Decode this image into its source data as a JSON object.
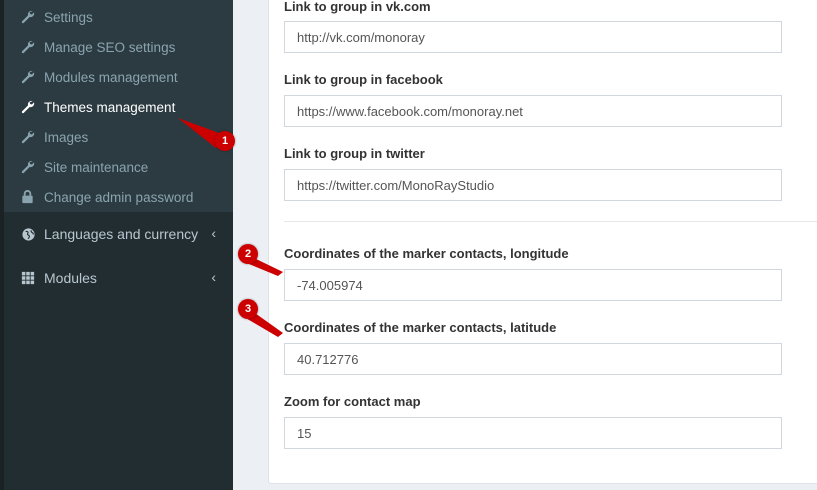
{
  "sidebar": {
    "submenu": [
      {
        "label": "Settings",
        "icon": "wrench-icon"
      },
      {
        "label": "Manage SEO settings",
        "icon": "wrench-icon"
      },
      {
        "label": "Modules management",
        "icon": "wrench-icon"
      },
      {
        "label": "Themes management",
        "icon": "wrench-icon",
        "active": true
      },
      {
        "label": "Images",
        "icon": "wrench-icon"
      },
      {
        "label": "Site maintenance",
        "icon": "wrench-icon"
      },
      {
        "label": "Change admin password",
        "icon": "lock-icon"
      }
    ],
    "menu": [
      {
        "label": "Languages and currency",
        "icon": "globe-icon"
      },
      {
        "label": "Modules",
        "icon": "grid-icon"
      }
    ]
  },
  "form": {
    "vk": {
      "label": "Link to group in vk.com",
      "value": "http://vk.com/monoray"
    },
    "facebook": {
      "label": "Link to group in facebook",
      "value": "https://www.facebook.com/monoray.net"
    },
    "twitter": {
      "label": "Link to group in twitter",
      "value": "https://twitter.com/MonoRayStudio"
    },
    "longitude": {
      "label": "Coordinates of the marker contacts, longitude",
      "value": "-74.005974"
    },
    "latitude": {
      "label": "Coordinates of the marker contacts, latitude",
      "value": "40.712776"
    },
    "zoom": {
      "label": "Zoom for contact map",
      "value": "15"
    }
  },
  "annotations": {
    "badge1": "1",
    "badge2": "2",
    "badge3": "3"
  },
  "colors": {
    "sidebar_bg": "#222d32",
    "submenu_bg": "#2c3b41",
    "annotation_red": "#cc0000"
  }
}
